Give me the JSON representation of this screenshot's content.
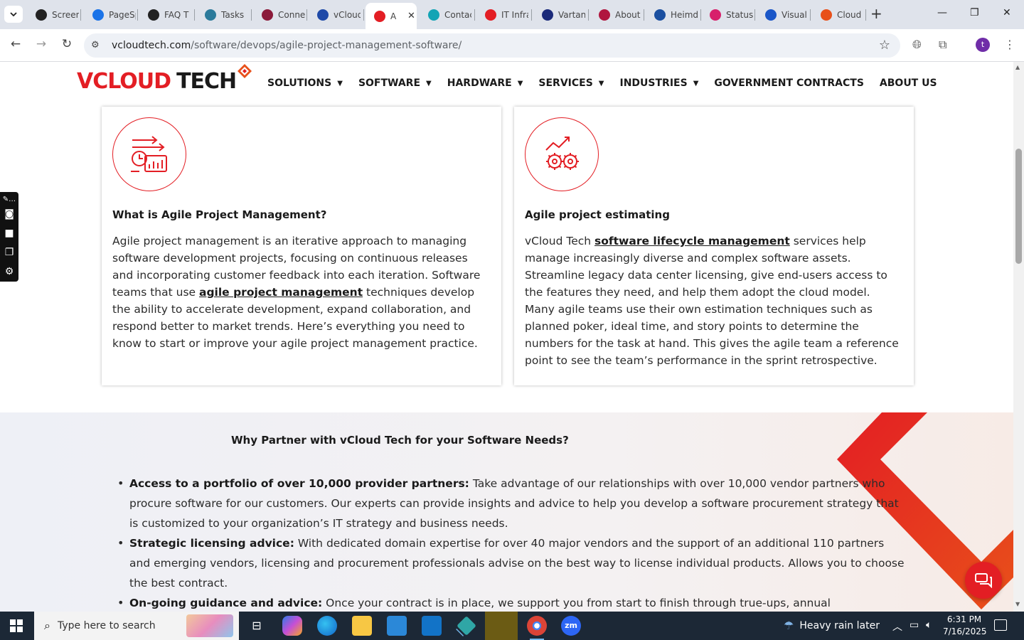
{
  "browser": {
    "tabs": [
      {
        "label": "Screen",
        "color": "#222222"
      },
      {
        "label": "PageSpeed",
        "color": "#1a73e8"
      },
      {
        "label": "FAQ T",
        "color": "#222222"
      },
      {
        "label": "Tasks",
        "color": "#2b7a9b"
      },
      {
        "label": "Connect",
        "color": "#8b1a3a"
      },
      {
        "label": "vCloud",
        "color": "#1f4aa8"
      },
      {
        "label": "A",
        "color": "#e31e24"
      },
      {
        "label": "Contact",
        "color": "#13a4b5"
      },
      {
        "label": "IT Infra",
        "color": "#e31e24"
      },
      {
        "label": "Vartana",
        "color": "#1b2a7a"
      },
      {
        "label": "About",
        "color": "#b0163f"
      },
      {
        "label": "Heimdal",
        "color": "#1a4fa0"
      },
      {
        "label": "Status",
        "color": "#d7206b"
      },
      {
        "label": "Visual",
        "color": "#1a56c8"
      },
      {
        "label": "Cloud",
        "color": "#e8501a"
      }
    ],
    "url_host": "vcloudtech.com",
    "url_path": "/software/devops/agile-project-management-software/",
    "profile_initial": "t"
  },
  "site": {
    "logo": {
      "v": "V",
      "cloud": "CLOUD",
      "tech": "TECH"
    },
    "menu": [
      {
        "label": "SOLUTIONS",
        "caret": true
      },
      {
        "label": "SOFTWARE",
        "caret": true
      },
      {
        "label": "HARDWARE",
        "caret": true
      },
      {
        "label": "SERVICES",
        "caret": true
      },
      {
        "label": "INDUSTRIES",
        "caret": true
      },
      {
        "label": "GOVERNMENT CONTRACTS",
        "caret": false
      },
      {
        "label": "ABOUT US",
        "caret": false
      }
    ],
    "cards": [
      {
        "title": "What is Agile Project Management?",
        "text_before": "Agile project management is an iterative approach to managing software development projects, focusing on continuous releases and incorporating customer feedback into each iteration. Software teams that use ",
        "link": "agile project management",
        "text_after": " techniques develop the ability to accelerate development, expand collaboration, and respond better to market trends. Here’s everything you need to know to start or improve your agile project management practice."
      },
      {
        "title": "Agile project estimating",
        "text_before": "vCloud Tech ",
        "link": "software lifecycle management",
        "text_after": " services help manage increasingly diverse and complex software assets. Streamline legacy data center licensing, give end-users access to the features they need, and help them adopt the cloud model. Many agile teams use their own estimation techniques such as planned poker, ideal time, and story points to determine the numbers for the task at hand. This gives the agile team a reference point to see the team’s performance in the sprint retrospective."
      }
    ],
    "partner": {
      "heading": "Why Partner with vCloud Tech for your Software Needs?",
      "items": [
        {
          "bold": "Access to a portfolio of over 10,000 provider partners:",
          "text": " Take advantage of our relationships with over 10,000 vendor partners who procure software for our customers. Our experts can provide insights and advice to help you develop a software procurement strategy that is customized to your organization’s IT strategy and business needs."
        },
        {
          "bold": "Strategic licensing advice:",
          "text": " With dedicated domain expertise for over 40 major vendors and the support of an additional 110 partners and emerging vendors, licensing and procurement professionals advise on the best way to license individual products. Allows you to choose the best contract."
        },
        {
          "bold": "On-going guidance and advice:",
          "text": " Once your contract is in place, we support you from start to finish through true-ups, annual maintenance"
        }
      ]
    },
    "brand_red": "#e31e24"
  },
  "taskbar": {
    "search_placeholder": "Type here to search",
    "weather": "Heavy rain later",
    "time": "6:31 PM",
    "date": "7/16/2025"
  }
}
